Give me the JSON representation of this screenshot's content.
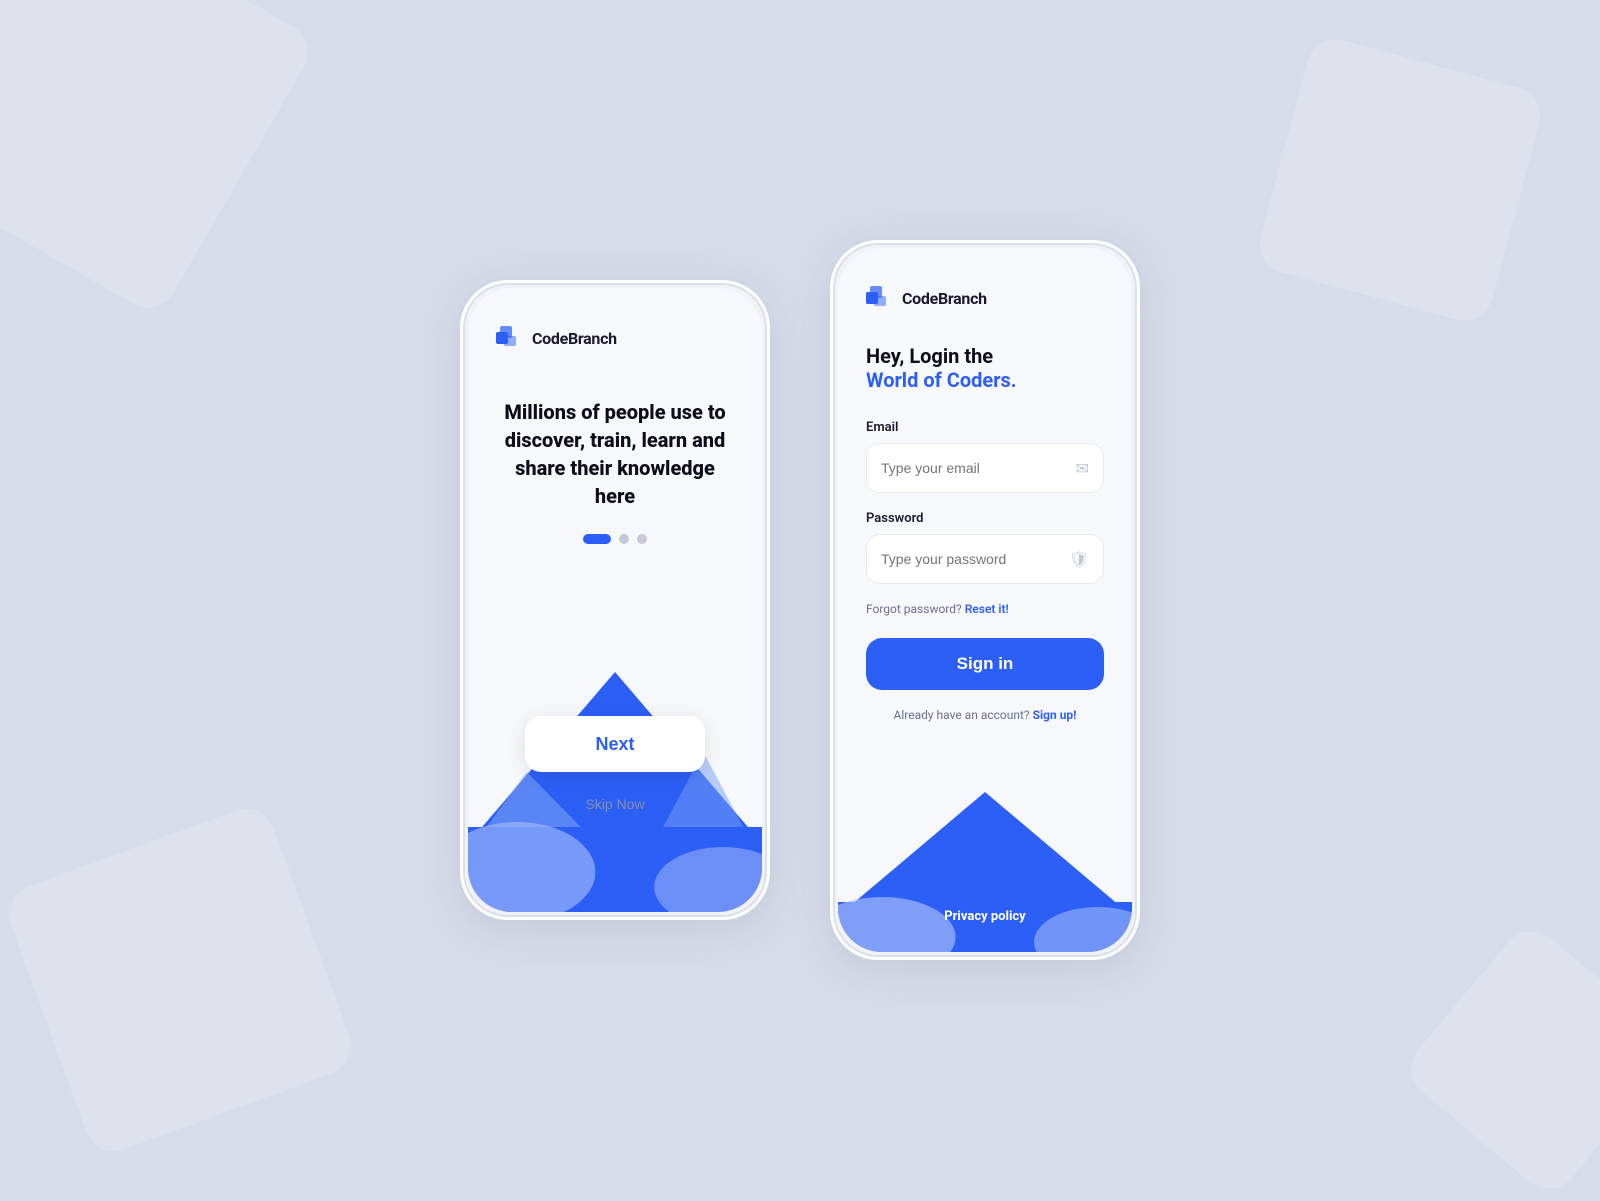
{
  "background": {
    "color": "#d8dce8"
  },
  "phone1": {
    "logo_text": "CodeBranch",
    "headline": "Millions of people use to discover, train, learn and share their knowledge here",
    "dots": [
      {
        "active": true
      },
      {
        "active": false
      },
      {
        "active": false
      }
    ],
    "next_button": "Next",
    "skip_button": "Skip Now",
    "accent_color": "#2c5ff6"
  },
  "phone2": {
    "logo_text": "CodeBranch",
    "headline_line1": "Hey, Login the",
    "headline_line2": "World of Coders.",
    "email_label": "Email",
    "email_placeholder": "Type your email",
    "password_label": "Password",
    "password_placeholder": "Type your password",
    "forgot_text": "Forgot password?",
    "reset_link": "Reset it!",
    "signin_button": "Sign in",
    "account_text": "Already have an account?",
    "signup_link": "Sign up!",
    "privacy_button": "Privacy policy",
    "accent_color": "#2c5ff6"
  }
}
